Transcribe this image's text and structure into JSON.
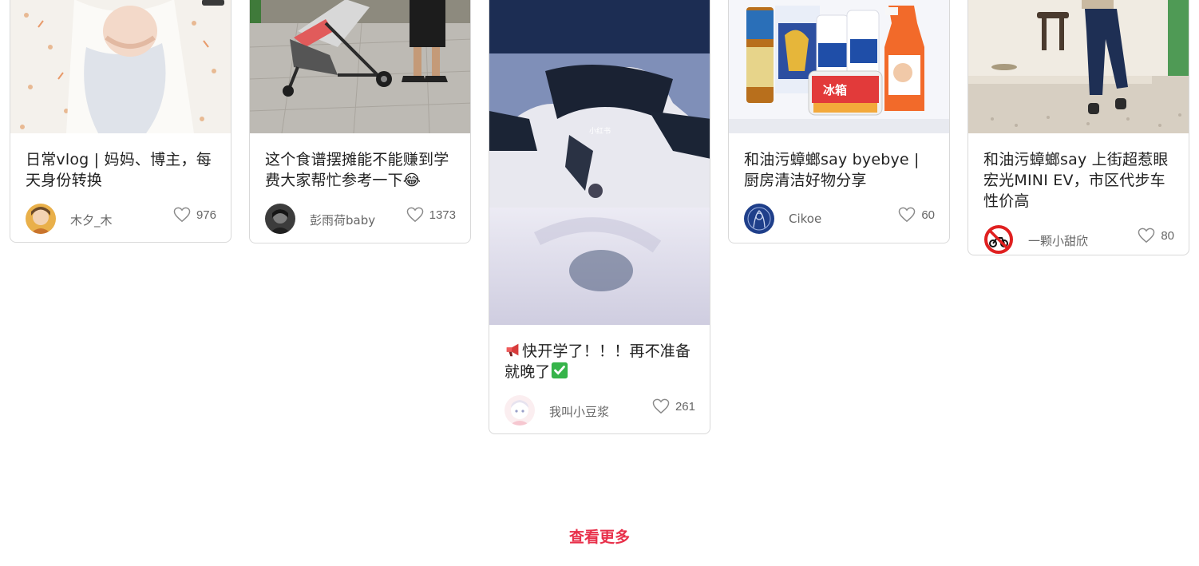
{
  "feed": {
    "cards": [
      {
        "title": "日常vlog | 妈妈、博主，每天身份转换",
        "author": "木夕_木",
        "likes": "976",
        "cover_icon": "baby-photo"
      },
      {
        "title": "这个食谱摆摊能不能赚到学费大家帮忙参考一下😂",
        "author": "彭雨荷baby",
        "likes": "1373",
        "cover_icon": "stroller-photo"
      },
      {
        "title": "快开学了！！！再不准备就晚了",
        "title_prefix_icon": "megaphone-icon",
        "title_suffix_icon": "check-mark-icon",
        "author": "我叫小豆浆",
        "likes": "261",
        "cover_icon": "motorcycle-photo",
        "cover_text": "小红书"
      },
      {
        "title": "和油污蟑螂say byebye | 厨房清洁好物分享",
        "author": "Cikoe",
        "likes": "60",
        "cover_icon": "cleaning-products-photo",
        "cover_text": "冰箱"
      },
      {
        "title": "和油污蟑螂say 上街超惹眼宏光MINI EV，市区代步车性价高",
        "author": "一颗小甜欣",
        "likes": "80",
        "cover_icon": "seated-person-photo"
      }
    ]
  },
  "load_more": "查看更多",
  "colors": {
    "accent": "#e8304a",
    "card_border": "#d9d9d9",
    "meta_text": "#666666"
  }
}
